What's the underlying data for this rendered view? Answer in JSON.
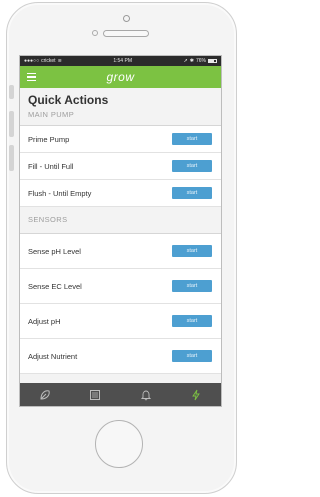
{
  "status_bar": {
    "carrier": "cricket",
    "time": "1:54 PM",
    "battery_percent": "76%",
    "battery_level": 0.76
  },
  "app": {
    "brand": "grow"
  },
  "page": {
    "title": "Quick Actions"
  },
  "main_pump": {
    "section_label": "MAIN PUMP",
    "actions": [
      {
        "label": "Prime Pump",
        "button": "start"
      },
      {
        "label": "Fill - Until Full",
        "button": "start"
      },
      {
        "label": "Flush - Until Empty",
        "button": "start"
      }
    ]
  },
  "sensors": {
    "section_label": "SENSORS",
    "actions": [
      {
        "label": "Sense pH Level",
        "button": "start"
      },
      {
        "label": "Sense EC Level",
        "button": "start"
      },
      {
        "label": "Adjust pH",
        "button": "start"
      },
      {
        "label": "Adjust Nutrient",
        "button": "start"
      }
    ]
  },
  "tab_bar": {
    "tabs": [
      {
        "icon": "leaf-icon",
        "active": false
      },
      {
        "icon": "list-icon",
        "active": false
      },
      {
        "icon": "bell-icon",
        "active": false
      },
      {
        "icon": "lightning-icon",
        "active": true
      }
    ]
  },
  "colors": {
    "accent_green": "#7cc242",
    "button_blue": "#4d9fd1",
    "tab_bar": "#4f4f4f"
  }
}
